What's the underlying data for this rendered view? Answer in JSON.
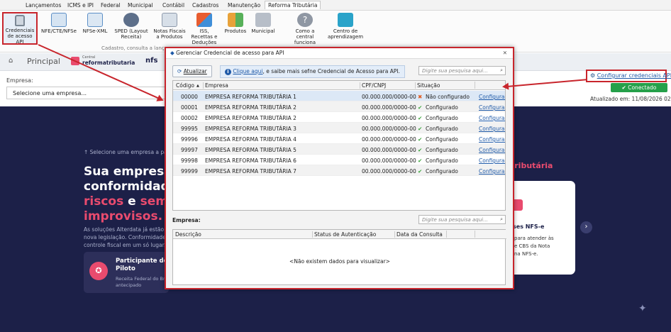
{
  "menu": [
    "Lançamentos",
    "ICMS e IPI",
    "Federal",
    "Municipal",
    "Contábil",
    "Cadastros",
    "Manutenção",
    "Reforma Tributária"
  ],
  "ribbon": {
    "items": [
      {
        "label": "Credenciais de acesso API",
        "icon": "lock-icon"
      },
      {
        "label": "NFE/CTE/NFSe",
        "icon": "nfe-icon"
      },
      {
        "label": "NFSe-XML",
        "icon": "xml-icon"
      },
      {
        "label": "SPED (Layout Receita)",
        "icon": "sped-icon"
      },
      {
        "label": "Notas Fiscais a Produtos",
        "icon": "notes-icon"
      },
      {
        "label": "ISS, Recettas e Deduções",
        "icon": "iss-icon"
      },
      {
        "label": "Produtos",
        "icon": "products-icon"
      },
      {
        "label": "Municipal",
        "icon": "municipal-icon"
      },
      {
        "label": "Como a central funciona",
        "icon": "help-icon"
      },
      {
        "label": "Centro de aprendizagem",
        "icon": "learning-icon"
      }
    ],
    "group_label": "Cadastro, consulta a lança"
  },
  "tabs": {
    "principal": "Principal",
    "reforma_small": "Central",
    "reforma_brand": "reformatributaria",
    "nfse": "nfs"
  },
  "empresa": {
    "label": "Empresa:",
    "placeholder": "Selecione uma empresa..."
  },
  "status": {
    "configurar": "Configurar credenciais API",
    "conectado": "Conectado",
    "atualizado": "Atualizado em: 11/08/2026 02:22"
  },
  "hero": {
    "hint": "↑ Selecione uma empresa a partir",
    "line1": "Sua empresa e",
    "line2": "conformidade",
    "line3_a": "riscos",
    "line3_b": " e ",
    "line3_c": "sem",
    "line4": "improvisos.",
    "para1": "As soluções Alterdata já estão p",
    "para2": "nova legislação. Conformidade,",
    "para3": "controle fiscal em um só lugar.",
    "tributaria": "tributária",
    "pilot_title1": "Participante de",
    "pilot_title2": "Piloto",
    "pilot_sub1": "Receita Federal do Br",
    "pilot_sub2": "antecipado",
    "card_title": "ses NFS-e",
    "card_l1": "para atender às",
    "card_l2": "e CBS da Nota",
    "card_l3": "na NFS-e."
  },
  "dialog": {
    "title": "Gerenciar Credencial de acesso para API",
    "close": "✕",
    "refresh": "Atualizar",
    "info_link": "Clique aqui",
    "info_rest": ", e saibe mais sefne Credencial de Acesso para API.",
    "search_placeholder": "Digite sua pesquisa aqui...",
    "columns": [
      "Código",
      "Empresa",
      "CPF/CNPJ",
      "Situação"
    ],
    "rows": [
      {
        "code": "00000",
        "empresa": "EMPRESA REFORMA TRIBUTÁRIA 1",
        "cnpj": "00.000.000/0000-00",
        "status": "Não configurado",
        "ok": false,
        "action": "Configurar"
      },
      {
        "code": "00001",
        "empresa": "EMPRESA REFORMA TRIBUTÁRIA 2",
        "cnpj": "00.000.000/0000-00",
        "status": "Configurado",
        "ok": true,
        "action": "Configurar"
      },
      {
        "code": "00002",
        "empresa": "EMPRESA REFORMA TRIBUTÁRIA 2",
        "cnpj": "00.000.000/0000-00",
        "status": "Configurado",
        "ok": true,
        "action": "Configurar"
      },
      {
        "code": "99995",
        "empresa": "EMPRESA REFORMA TRIBUTÁRIA 3",
        "cnpj": "00.000.000/0000-00",
        "status": "Configurado",
        "ok": true,
        "action": "Configurar"
      },
      {
        "code": "99996",
        "empresa": "EMPRESA REFORMA TRIBUTÁRIA 4",
        "cnpj": "00.000.000/0000-00",
        "status": "Configurado",
        "ok": true,
        "action": "Configurar"
      },
      {
        "code": "99997",
        "empresa": "EMPRESA REFORMA TRIBUTÁRIA 5",
        "cnpj": "00.000.000/0000-00",
        "status": "Configurado",
        "ok": true,
        "action": "Configurar"
      },
      {
        "code": "99998",
        "empresa": "EMPRESA REFORMA TRIBUTÁRIA 6",
        "cnpj": "00.000.000/0000-00",
        "status": "Configurado",
        "ok": true,
        "action": "Configurar"
      },
      {
        "code": "99999",
        "empresa": "EMPRESA REFORMA TRIBUTÁRIA 7",
        "cnpj": "00.000.000/0000-00",
        "status": "Configurado",
        "ok": true,
        "action": "Configurar"
      }
    ],
    "empresa_label": "Empresa:",
    "columns2": [
      "Descrição",
      "Status de Autenticação",
      "Data da Consulta"
    ],
    "empty_text": "<Não existem dados para visualizar>"
  },
  "colors": {
    "accent_red": "#c8252c",
    "hero_bg": "#1c2048",
    "link": "#1f5aa8",
    "ok_green": "#25a04a"
  }
}
